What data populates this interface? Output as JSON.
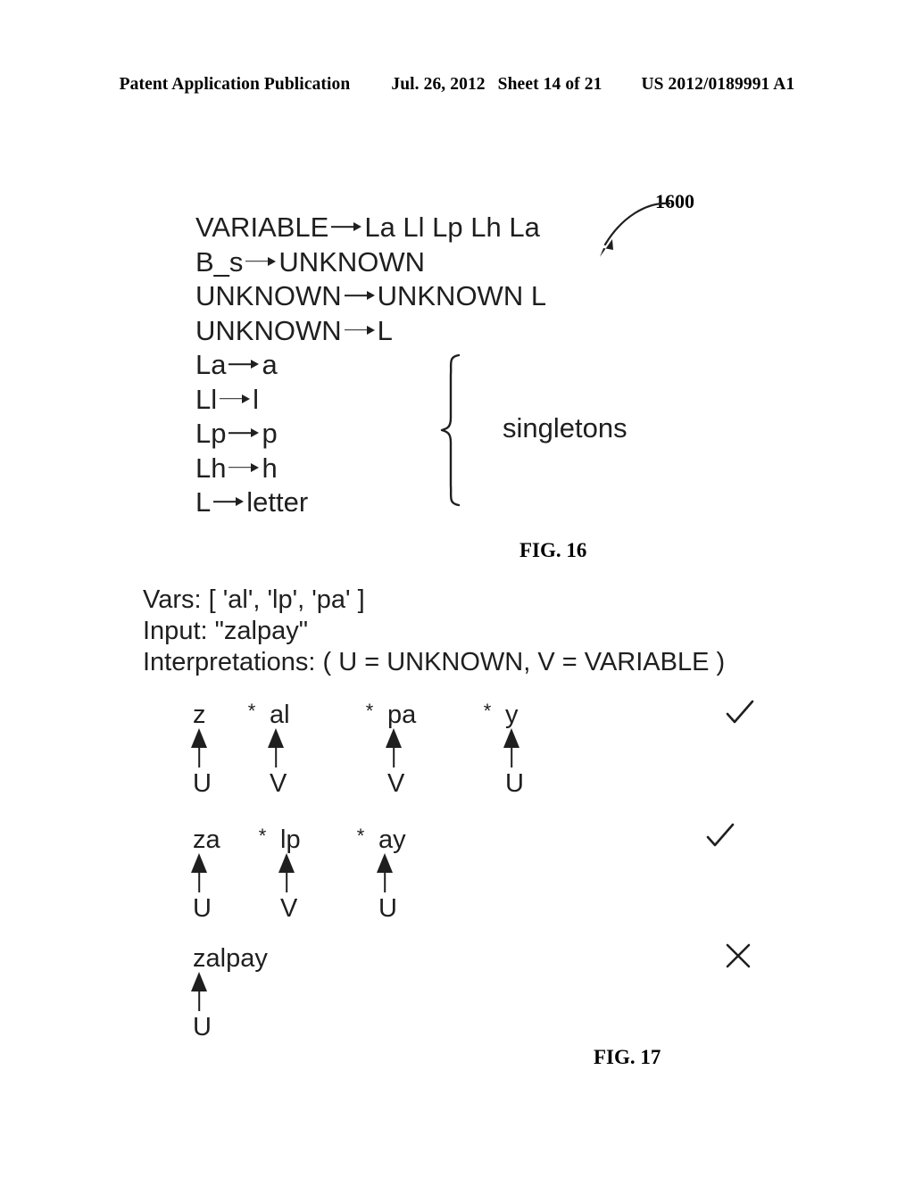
{
  "header": {
    "publication": "Patent Application Publication",
    "date": "Jul. 26, 2012",
    "sheet": "Sheet 14 of 21",
    "pub_number": "US 2012/0189991 A1"
  },
  "fig16": {
    "caption": "FIG. 16",
    "reference_numeral": "1600",
    "arrow_glyph": "→",
    "rules": [
      {
        "lhs": "VARIABLE",
        "rhs": "La Ll Lp Lh La",
        "singleton": false
      },
      {
        "lhs": "B_s",
        "rhs": "UNKNOWN",
        "singleton": false
      },
      {
        "lhs": "UNKNOWN",
        "rhs": "UNKNOWN L",
        "singleton": false
      },
      {
        "lhs": "UNKNOWN",
        "rhs": "L",
        "singleton": false
      },
      {
        "lhs": "La",
        "rhs": "a",
        "singleton": true
      },
      {
        "lhs": "Ll",
        "rhs": "l",
        "singleton": true
      },
      {
        "lhs": "Lp",
        "rhs": "p",
        "singleton": true
      },
      {
        "lhs": "Lh",
        "rhs": "h",
        "singleton": true
      },
      {
        "lhs": "L",
        "rhs": "letter",
        "singleton": true
      }
    ],
    "brace_label": "singletons"
  },
  "fig17": {
    "caption": "FIG. 17",
    "vars_line": "Vars: [ 'al', 'lp', 'pa' ]",
    "input_line": "Input: \"zalpay\"",
    "interpretations_line": "Interpretations: ( U = UNKNOWN, V = VARIABLE )",
    "separator": "*",
    "rows": [
      {
        "tokens": [
          "z",
          "al",
          "pa",
          "y"
        ],
        "labels": [
          "U",
          "V",
          "V",
          "U"
        ],
        "verdict": "check",
        "verdict_glyph": "✓"
      },
      {
        "tokens": [
          "za",
          "lp",
          "ay"
        ],
        "labels": [
          "U",
          "V",
          "U"
        ],
        "verdict": "check",
        "verdict_glyph": "✓"
      },
      {
        "tokens": [
          "zalpay"
        ],
        "labels": [
          "U"
        ],
        "verdict": "cross",
        "verdict_glyph": "X"
      }
    ]
  },
  "colors": {
    "ink": "#1f1f1f",
    "header_ink": "#000000",
    "page": "#ffffff"
  }
}
